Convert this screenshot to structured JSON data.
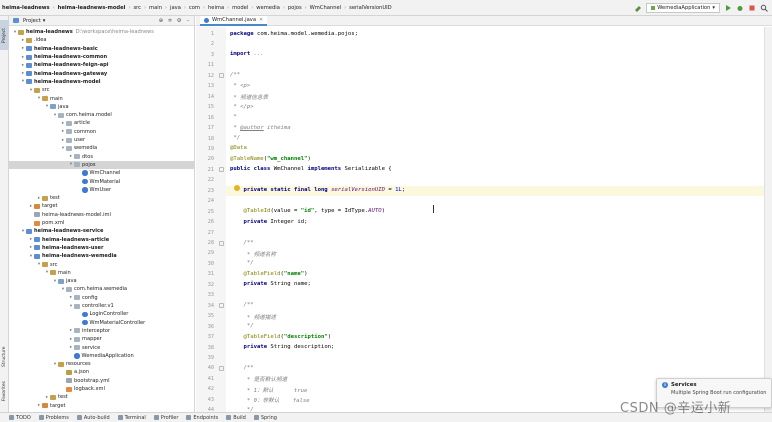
{
  "navbar": {
    "breadcrumbs": [
      "heima-leadnews",
      "heima-leadnews-model",
      "src",
      "main",
      "java",
      "com",
      "heima",
      "model",
      "wemedia",
      "pojos",
      "WmChannel",
      "serialVersionUID"
    ],
    "run_config": "WemediaApplication"
  },
  "left_stripe": {
    "tabs": [
      "Project",
      "Structure",
      "Favorites"
    ]
  },
  "project_panel": {
    "title": "Project",
    "tree": [
      {
        "depth": 0,
        "label": "heima-leadnews",
        "path": "D:\\workspace\\heima-leadnews",
        "icon": "folder-icon",
        "bold": true,
        "arrow": "open"
      },
      {
        "depth": 1,
        "label": ".idea",
        "icon": "folder-icon",
        "arrow": "closed"
      },
      {
        "depth": 1,
        "label": "heima-leadnews-basic",
        "icon": "module-icon",
        "bold": true,
        "arrow": "closed"
      },
      {
        "depth": 1,
        "label": "heima-leadnews-common",
        "icon": "module-icon",
        "bold": true,
        "arrow": "closed"
      },
      {
        "depth": 1,
        "label": "heima-leadnews-feign-api",
        "icon": "module-icon",
        "bold": true,
        "arrow": "closed"
      },
      {
        "depth": 1,
        "label": "heima-leadnews-gateway",
        "icon": "module-icon",
        "bold": true,
        "arrow": "closed"
      },
      {
        "depth": 1,
        "label": "heima-leadnews-model",
        "icon": "module-icon",
        "bold": true,
        "arrow": "open"
      },
      {
        "depth": 2,
        "label": "src",
        "icon": "folder-icon",
        "arrow": "open"
      },
      {
        "depth": 3,
        "label": "main",
        "icon": "folder-icon",
        "arrow": "open"
      },
      {
        "depth": 4,
        "label": "java",
        "icon": "source-root-icon",
        "arrow": "open"
      },
      {
        "depth": 5,
        "label": "com.heima.model",
        "icon": "package-icon",
        "arrow": "open"
      },
      {
        "depth": 6,
        "label": "article",
        "icon": "package-icon",
        "arrow": "closed"
      },
      {
        "depth": 6,
        "label": "common",
        "icon": "package-icon",
        "arrow": "closed"
      },
      {
        "depth": 6,
        "label": "user",
        "icon": "package-icon",
        "arrow": "closed"
      },
      {
        "depth": 6,
        "label": "wemedia",
        "icon": "package-icon",
        "arrow": "open"
      },
      {
        "depth": 7,
        "label": "dtos",
        "icon": "package-icon",
        "arrow": "closed"
      },
      {
        "depth": 7,
        "label": "pojos",
        "icon": "package-icon",
        "arrow": "open",
        "selected": true
      },
      {
        "depth": 8,
        "label": "WmChannel",
        "icon": "class-icon"
      },
      {
        "depth": 8,
        "label": "WmMaterial",
        "icon": "class-icon"
      },
      {
        "depth": 8,
        "label": "WmUser",
        "icon": "class-icon"
      },
      {
        "depth": 3,
        "label": "test",
        "icon": "folder-icon",
        "arrow": "closed"
      },
      {
        "depth": 2,
        "label": "target",
        "icon": "target-folder-icon",
        "arrow": "closed"
      },
      {
        "depth": 2,
        "label": "heima-leadnews-model.iml",
        "icon": "file-icon"
      },
      {
        "depth": 2,
        "label": "pom.xml",
        "icon": "xml-file-icon"
      },
      {
        "depth": 1,
        "label": "heima-leadnews-service",
        "icon": "module-icon",
        "bold": true,
        "arrow": "open"
      },
      {
        "depth": 2,
        "label": "heima-leadnews-article",
        "icon": "module-icon",
        "bold": true,
        "arrow": "closed"
      },
      {
        "depth": 2,
        "label": "heima-leadnews-user",
        "icon": "module-icon",
        "bold": true,
        "arrow": "closed"
      },
      {
        "depth": 2,
        "label": "heima-leadnews-wemedia",
        "icon": "module-icon",
        "bold": true,
        "arrow": "open"
      },
      {
        "depth": 3,
        "label": "src",
        "icon": "folder-icon",
        "arrow": "open"
      },
      {
        "depth": 4,
        "label": "main",
        "icon": "folder-icon",
        "arrow": "open"
      },
      {
        "depth": 5,
        "label": "java",
        "icon": "source-root-icon",
        "arrow": "open"
      },
      {
        "depth": 6,
        "label": "com.heima.wemedia",
        "icon": "package-icon",
        "arrow": "open"
      },
      {
        "depth": 7,
        "label": "config",
        "icon": "package-icon",
        "arrow": "closed"
      },
      {
        "depth": 7,
        "label": "controller.v1",
        "icon": "package-icon",
        "arrow": "open"
      },
      {
        "depth": 8,
        "label": "LoginController",
        "icon": "class-icon"
      },
      {
        "depth": 8,
        "label": "WmMaterialController",
        "icon": "class-icon"
      },
      {
        "depth": 7,
        "label": "interceptor",
        "icon": "package-icon",
        "arrow": "closed"
      },
      {
        "depth": 7,
        "label": "mapper",
        "icon": "package-icon",
        "arrow": "closed"
      },
      {
        "depth": 7,
        "label": "service",
        "icon": "package-icon",
        "arrow": "closed"
      },
      {
        "depth": 7,
        "label": "WemediaApplication",
        "icon": "class-icon"
      },
      {
        "depth": 5,
        "label": "resources",
        "icon": "resources-folder-icon",
        "arrow": "open"
      },
      {
        "depth": 6,
        "label": "a.json",
        "icon": "json-file-icon"
      },
      {
        "depth": 6,
        "label": "bootstrap.yml",
        "icon": "yml-file-icon"
      },
      {
        "depth": 6,
        "label": "logback.xml",
        "icon": "xml-file-icon"
      },
      {
        "depth": 4,
        "label": "test",
        "icon": "folder-icon",
        "arrow": "closed"
      },
      {
        "depth": 3,
        "label": "target",
        "icon": "target-folder-icon",
        "arrow": "closed"
      }
    ]
  },
  "editor": {
    "tab_label": "WmChannel.java",
    "current_line": 23,
    "lines": [
      {
        "n": 1,
        "html": "<span class=\"kw\">package</span> com.heima.model.wemedia.pojos;"
      },
      {
        "n": 2,
        "html": ""
      },
      {
        "n": 3,
        "html": "<span class=\"kw\">import</span> <span class=\"cm\">...</span>"
      },
      {
        "n": 11,
        "html": ""
      },
      {
        "n": 12,
        "html": "<span class=\"cm\">/**</span>"
      },
      {
        "n": 13,
        "html": "<span class=\"cm\"> * &lt;p&gt;</span>"
      },
      {
        "n": 14,
        "html": "<span class=\"cm\"> * 频道信息表</span>"
      },
      {
        "n": 15,
        "html": "<span class=\"cm\"> * &lt;/p&gt;</span>"
      },
      {
        "n": 16,
        "html": "<span class=\"cm\"> *</span>"
      },
      {
        "n": 17,
        "html": "<span class=\"cm\"> * <u>@author</u> itheima</span>"
      },
      {
        "n": 18,
        "html": "<span class=\"cm\"> */</span>"
      },
      {
        "n": 19,
        "html": "<span class=\"an\">@Data</span>"
      },
      {
        "n": 20,
        "html": "<span class=\"an\">@TableName</span>(<span class=\"str\">\"wm_channel\"</span>)"
      },
      {
        "n": 21,
        "html": "<span class=\"kw\">public class</span> WmChannel <span class=\"kw\">implements</span> Serializable {"
      },
      {
        "n": 22,
        "html": ""
      },
      {
        "n": 23,
        "html": "    <span class=\"kw\">private static final long</span> <span class=\"it\">serialVersionUID</span> = <span class=\"num\">1L</span>;"
      },
      {
        "n": 24,
        "html": ""
      },
      {
        "n": 25,
        "html": "    <span class=\"an\">@TableId</span>(value = <span class=\"str\">\"id\"</span>, type = IdType.<span class=\"it\">AUTO</span>)"
      },
      {
        "n": 26,
        "html": "    <span class=\"kw\">private</span> Integer id;"
      },
      {
        "n": 27,
        "html": ""
      },
      {
        "n": 28,
        "html": "    <span class=\"cm\">/**</span>"
      },
      {
        "n": 29,
        "html": "<span class=\"cm\">     * 频道名称</span>"
      },
      {
        "n": 30,
        "html": "<span class=\"cm\">     */</span>"
      },
      {
        "n": 31,
        "html": "    <span class=\"an\">@TableField</span>(<span class=\"str\">\"name\"</span>)"
      },
      {
        "n": 32,
        "html": "    <span class=\"kw\">private</span> String name;"
      },
      {
        "n": 33,
        "html": ""
      },
      {
        "n": 34,
        "html": "    <span class=\"cm\">/**</span>"
      },
      {
        "n": 35,
        "html": "<span class=\"cm\">     * 频道描述</span>"
      },
      {
        "n": 36,
        "html": "<span class=\"cm\">     */</span>"
      },
      {
        "n": 37,
        "html": "    <span class=\"an\">@TableField</span>(<span class=\"str\">\"description\"</span>)"
      },
      {
        "n": 38,
        "html": "    <span class=\"kw\">private</span> String description;"
      },
      {
        "n": 39,
        "html": ""
      },
      {
        "n": 40,
        "html": "    <span class=\"cm\">/**</span>"
      },
      {
        "n": 41,
        "html": "<span class=\"cm\">     * 是否默认频道</span>"
      },
      {
        "n": 42,
        "html": "<span class=\"cm\">     * 1：默认      true</span>"
      },
      {
        "n": 43,
        "html": "<span class=\"cm\">     * 0：非默认    false</span>"
      },
      {
        "n": 44,
        "html": "<span class=\"cm\">     */</span>"
      }
    ]
  },
  "bottom_toolbar": {
    "items": [
      {
        "label": "TODO",
        "icon": "todo-icon"
      },
      {
        "label": "Problems",
        "icon": "problems-icon"
      },
      {
        "label": "Auto-build",
        "icon": "build-icon"
      },
      {
        "label": "Terminal",
        "icon": "terminal-icon"
      },
      {
        "label": "Profiler",
        "icon": "profiler-icon"
      },
      {
        "label": "Endpoints",
        "icon": "endpoints-icon"
      },
      {
        "label": "Build",
        "icon": "build-icon"
      },
      {
        "label": "Spring",
        "icon": "spring-icon"
      }
    ]
  },
  "services_popup": {
    "title": "Services",
    "message": "Multiple Spring Boot run configurations were detected."
  },
  "watermark": "CSDN @辛运小新",
  "colors": {
    "selection": "#d5d5d5",
    "current_line": "#fbf8dd",
    "keyword": "#000080",
    "comment": "#808080",
    "annotation": "#808000",
    "string": "#008000"
  }
}
